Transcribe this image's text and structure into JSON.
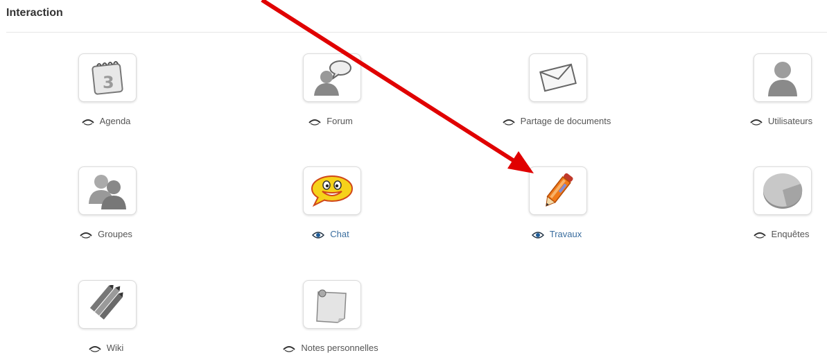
{
  "section": {
    "title": "Interaction"
  },
  "tools": [
    {
      "label": "Agenda",
      "visible": false,
      "icon": "calendar-icon"
    },
    {
      "label": "Forum",
      "visible": false,
      "icon": "forum-user-icon"
    },
    {
      "label": "Partage de documents",
      "visible": false,
      "icon": "envelope-icon"
    },
    {
      "label": "Utilisateurs",
      "visible": false,
      "icon": "user-icon"
    },
    {
      "label": "Groupes",
      "visible": false,
      "icon": "users-group-icon"
    },
    {
      "label": "Chat",
      "visible": true,
      "icon": "smiley-chat-icon"
    },
    {
      "label": "Travaux",
      "visible": true,
      "icon": "pencil-icon"
    },
    {
      "label": "Enquêtes",
      "visible": false,
      "icon": "pie-survey-icon"
    },
    {
      "label": "Wiki",
      "visible": false,
      "icon": "pencils-wiki-icon"
    },
    {
      "label": "Notes personnelles",
      "visible": false,
      "icon": "sticky-note-icon"
    }
  ],
  "colors": {
    "active_link": "#3a6d9e",
    "inactive_text": "#555555",
    "annotation_arrow": "#e00000"
  }
}
